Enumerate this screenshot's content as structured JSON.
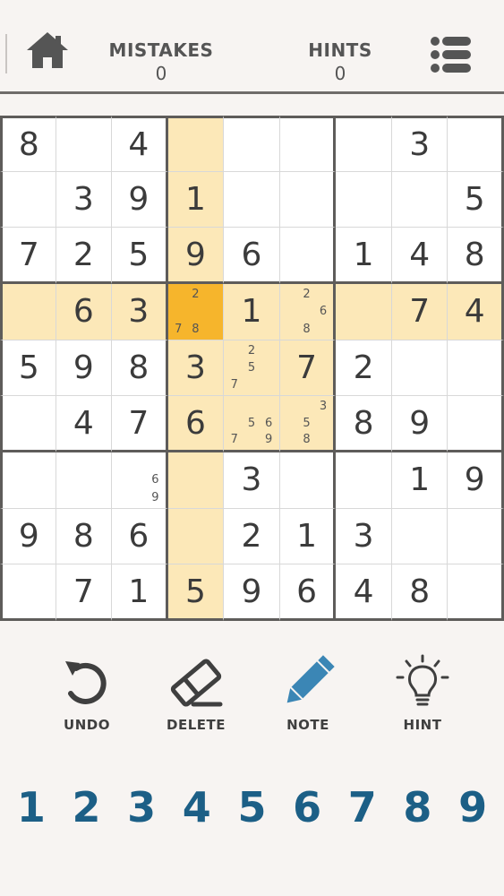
{
  "header": {
    "mistakes_label": "MISTAKES",
    "mistakes_value": "0",
    "hints_label": "HINTS",
    "hints_value": "0"
  },
  "board": {
    "selected": [
      3,
      3
    ],
    "highlight_row": 3,
    "highlight_col": 3,
    "highlight_box": [
      1,
      1
    ],
    "values": [
      [
        "8",
        "",
        "4",
        "",
        "",
        "",
        "",
        "3",
        ""
      ],
      [
        "",
        "3",
        "9",
        "1",
        "",
        "",
        "",
        "",
        "5"
      ],
      [
        "7",
        "2",
        "5",
        "9",
        "6",
        "",
        "1",
        "4",
        "8"
      ],
      [
        "",
        "6",
        "3",
        "",
        "1",
        "",
        "",
        "7",
        "4"
      ],
      [
        "5",
        "9",
        "8",
        "3",
        "",
        "7",
        "2",
        "",
        ""
      ],
      [
        "",
        "4",
        "7",
        "6",
        "",
        "",
        "8",
        "9",
        ""
      ],
      [
        "",
        "",
        "",
        "",
        "3",
        "",
        "",
        "1",
        "9"
      ],
      [
        "9",
        "8",
        "6",
        "",
        "2",
        "1",
        "3",
        "",
        ""
      ],
      [
        "",
        "7",
        "1",
        "5",
        "9",
        "6",
        "4",
        "8",
        ""
      ]
    ],
    "notes": {
      "3-3": [
        "2",
        "7",
        "8"
      ],
      "3-5": [
        "2",
        "6",
        "8"
      ],
      "4-4": [
        "2",
        "5",
        "7"
      ],
      "5-4": [
        "5",
        "6",
        "7",
        "9"
      ],
      "5-5": [
        "3",
        "5",
        "8"
      ],
      "6-2": [
        "6",
        "9"
      ]
    }
  },
  "tools": {
    "undo": "UNDO",
    "delete": "DELETE",
    "note": "NOTE",
    "hint": "HINT"
  },
  "numpad": [
    "1",
    "2",
    "3",
    "4",
    "5",
    "6",
    "7",
    "8",
    "9"
  ],
  "colors": {
    "highlight": "#fce8b8",
    "selected": "#f6b52c",
    "numpad": "#1c5f86",
    "note_pencil": "#3b86b5"
  }
}
